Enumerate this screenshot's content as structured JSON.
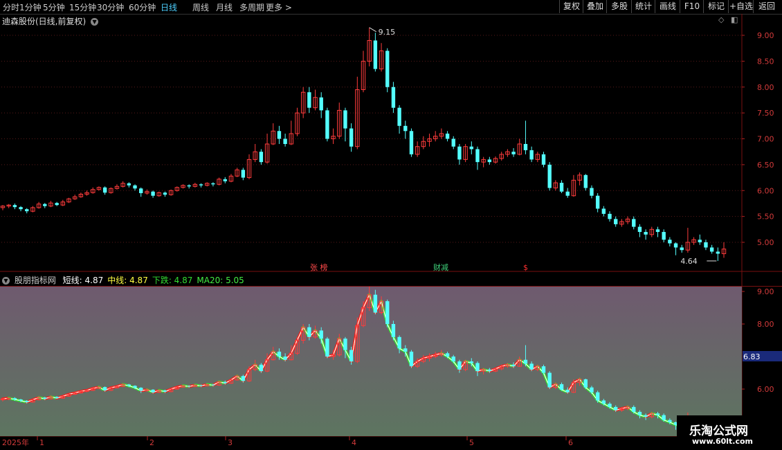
{
  "toolbar": {
    "periods": [
      "分时",
      "1分钟",
      "5分钟",
      "15分钟",
      "30分钟",
      "60分钟",
      "日线",
      "周线",
      "月线",
      "多周期",
      "更多"
    ],
    "active_period": "日线",
    "right_buttons": [
      "复权",
      "叠加",
      "多股",
      "统计",
      "画线",
      "F10",
      "标记",
      "+自选",
      "返回"
    ]
  },
  "main_panel": {
    "title": "迪森股份(日线,前复权)",
    "high_label": "9.15",
    "low_label": "4.64",
    "events": [
      {
        "text": "张 榜",
        "color": "#ff4a4a"
      },
      {
        "text": "财减",
        "color": "#3fd17a"
      },
      {
        "text": "$",
        "color": "#ff3030"
      }
    ],
    "y_ticks": [
      "9.00",
      "8.50",
      "8.00",
      "7.50",
      "7.00",
      "6.50",
      "6.00",
      "5.50",
      "5.00"
    ]
  },
  "indicator_panel": {
    "name": "股朋指标网",
    "legend": [
      {
        "label": "短线:",
        "value": "4.87",
        "color": "#ffffff"
      },
      {
        "label": "中线:",
        "value": "4.87",
        "color": "#ffff44"
      },
      {
        "label": "下跌:",
        "value": "4.87",
        "color": "#33dd33"
      },
      {
        "label": "MA20:",
        "value": "5.05",
        "color": "#44ee44"
      }
    ],
    "y_ticks": [
      "9.00",
      "8.00",
      "6.00"
    ],
    "current_value": "6.83"
  },
  "x_axis": {
    "year": "2025年",
    "months": [
      "1",
      "2",
      "3",
      "4",
      "5",
      "6"
    ]
  },
  "watermark": {
    "line1": "乐淘公式网",
    "line2": "www.60lt.com"
  },
  "chart_data": {
    "type": "candlestick",
    "title": "迪森股份(日线,前复权)",
    "y_range": [
      4.6,
      9.3
    ],
    "candles": [
      [
        5.67,
        5.7,
        5.62,
        5.72
      ],
      [
        5.7,
        5.72,
        5.66,
        5.74
      ],
      [
        5.72,
        5.68,
        5.64,
        5.75
      ],
      [
        5.68,
        5.64,
        5.6,
        5.7
      ],
      [
        5.64,
        5.6,
        5.56,
        5.66
      ],
      [
        5.6,
        5.67,
        5.58,
        5.7
      ],
      [
        5.67,
        5.74,
        5.65,
        5.78
      ],
      [
        5.74,
        5.7,
        5.66,
        5.76
      ],
      [
        5.7,
        5.76,
        5.68,
        5.8
      ],
      [
        5.76,
        5.72,
        5.7,
        5.78
      ],
      [
        5.72,
        5.78,
        5.7,
        5.82
      ],
      [
        5.78,
        5.84,
        5.76,
        5.86
      ],
      [
        5.84,
        5.88,
        5.82,
        5.92
      ],
      [
        5.88,
        5.93,
        5.86,
        5.96
      ],
      [
        5.93,
        5.96,
        5.9,
        6.0
      ],
      [
        5.96,
        6.02,
        5.94,
        6.06
      ],
      [
        6.02,
        6.06,
        6.0,
        6.08
      ],
      [
        6.06,
        5.96,
        5.92,
        6.08
      ],
      [
        5.96,
        6.04,
        5.94,
        6.06
      ],
      [
        6.04,
        6.08,
        6.02,
        6.12
      ],
      [
        6.08,
        6.14,
        6.06,
        6.18
      ],
      [
        6.14,
        6.1,
        6.06,
        6.16
      ],
      [
        6.1,
        6.04,
        6.0,
        6.12
      ],
      [
        6.04,
        5.95,
        5.88,
        6.06
      ],
      [
        5.95,
        5.98,
        5.92,
        6.02
      ],
      [
        5.98,
        5.9,
        5.86,
        6.0
      ],
      [
        5.9,
        5.96,
        5.88,
        5.98
      ],
      [
        5.96,
        5.92,
        5.88,
        5.98
      ],
      [
        5.92,
        6.0,
        5.9,
        6.02
      ],
      [
        6.0,
        6.06,
        5.98,
        6.08
      ],
      [
        6.06,
        6.1,
        6.04,
        6.12
      ],
      [
        6.1,
        6.08,
        6.04,
        6.12
      ],
      [
        6.08,
        6.12,
        6.06,
        6.15
      ],
      [
        6.12,
        6.1,
        6.06,
        6.14
      ],
      [
        6.1,
        6.14,
        6.08,
        6.16
      ],
      [
        6.14,
        6.12,
        6.08,
        6.16
      ],
      [
        6.12,
        6.22,
        6.1,
        6.25
      ],
      [
        6.22,
        6.18,
        6.14,
        6.26
      ],
      [
        6.18,
        6.28,
        6.16,
        6.32
      ],
      [
        6.28,
        6.4,
        6.26,
        6.44
      ],
      [
        6.4,
        6.25,
        6.2,
        6.44
      ],
      [
        6.25,
        6.6,
        6.22,
        6.7
      ],
      [
        6.6,
        6.75,
        6.55,
        6.9
      ],
      [
        6.75,
        6.55,
        6.5,
        6.8
      ],
      [
        6.55,
        6.9,
        6.52,
        7.1
      ],
      [
        6.9,
        7.15,
        6.88,
        7.3
      ],
      [
        7.15,
        7.0,
        6.9,
        7.25
      ],
      [
        7.0,
        6.9,
        6.85,
        7.1
      ],
      [
        6.9,
        7.1,
        6.88,
        7.35
      ],
      [
        7.1,
        7.5,
        7.05,
        7.6
      ],
      [
        7.5,
        7.9,
        7.4,
        8.0
      ],
      [
        7.9,
        7.6,
        7.5,
        8.0
      ],
      [
        7.6,
        7.8,
        7.55,
        7.95
      ],
      [
        7.8,
        7.55,
        7.4,
        7.9
      ],
      [
        7.55,
        7.0,
        6.95,
        7.6
      ],
      [
        7.0,
        7.05,
        6.9,
        7.2
      ],
      [
        7.05,
        7.55,
        7.0,
        7.7
      ],
      [
        7.55,
        7.2,
        6.95,
        7.6
      ],
      [
        7.2,
        6.85,
        6.75,
        7.3
      ],
      [
        6.85,
        7.95,
        6.8,
        8.2
      ],
      [
        7.95,
        8.5,
        7.9,
        8.7
      ],
      [
        8.5,
        8.9,
        8.4,
        9.15
      ],
      [
        8.9,
        8.35,
        8.3,
        9.05
      ],
      [
        8.35,
        8.7,
        8.3,
        8.85
      ],
      [
        8.7,
        8.0,
        7.9,
        8.75
      ],
      [
        8.0,
        7.6,
        7.5,
        8.1
      ],
      [
        7.6,
        7.25,
        7.1,
        7.65
      ],
      [
        7.25,
        7.15,
        7.0,
        7.35
      ],
      [
        7.15,
        6.7,
        6.65,
        7.2
      ],
      [
        6.7,
        6.85,
        6.65,
        6.95
      ],
      [
        6.85,
        6.95,
        6.8,
        7.05
      ],
      [
        6.95,
        7.0,
        6.85,
        7.1
      ],
      [
        7.0,
        7.05,
        6.95,
        7.15
      ],
      [
        7.05,
        7.1,
        7.0,
        7.2
      ],
      [
        7.1,
        7.0,
        6.95,
        7.15
      ],
      [
        7.0,
        6.85,
        6.8,
        7.05
      ],
      [
        6.85,
        6.6,
        6.5,
        6.9
      ],
      [
        6.6,
        6.85,
        6.55,
        6.9
      ],
      [
        6.85,
        6.8,
        6.7,
        6.95
      ],
      [
        6.8,
        6.55,
        6.4,
        6.85
      ],
      [
        6.55,
        6.6,
        6.45,
        6.65
      ],
      [
        6.6,
        6.55,
        6.5,
        6.65
      ],
      [
        6.55,
        6.62,
        6.52,
        6.66
      ],
      [
        6.62,
        6.7,
        6.58,
        6.75
      ],
      [
        6.7,
        6.75,
        6.65,
        6.8
      ],
      [
        6.75,
        6.7,
        6.65,
        6.82
      ],
      [
        6.7,
        6.9,
        6.68,
        7.0
      ],
      [
        6.9,
        6.78,
        6.7,
        7.35
      ],
      [
        6.78,
        6.6,
        6.55,
        6.85
      ],
      [
        6.6,
        6.7,
        6.55,
        6.75
      ],
      [
        6.7,
        6.5,
        6.45,
        6.75
      ],
      [
        6.5,
        6.05,
        6.0,
        6.55
      ],
      [
        6.05,
        6.15,
        6.0,
        6.2
      ],
      [
        6.15,
        5.98,
        5.95,
        6.2
      ],
      [
        5.98,
        5.9,
        5.86,
        6.05
      ],
      [
        5.9,
        6.2,
        5.88,
        6.3
      ],
      [
        6.2,
        6.3,
        6.1,
        6.35
      ],
      [
        6.3,
        6.05,
        6.0,
        6.32
      ],
      [
        6.05,
        5.9,
        5.85,
        6.1
      ],
      [
        5.9,
        5.65,
        5.58,
        5.95
      ],
      [
        5.65,
        5.55,
        5.5,
        5.7
      ],
      [
        5.55,
        5.45,
        5.4,
        5.6
      ],
      [
        5.45,
        5.35,
        5.3,
        5.5
      ],
      [
        5.35,
        5.4,
        5.3,
        5.45
      ],
      [
        5.4,
        5.45,
        5.35,
        5.5
      ],
      [
        5.45,
        5.3,
        5.25,
        5.5
      ],
      [
        5.3,
        5.2,
        5.1,
        5.35
      ],
      [
        5.2,
        5.15,
        5.05,
        5.25
      ],
      [
        5.15,
        5.25,
        5.1,
        5.3
      ],
      [
        5.25,
        5.2,
        5.1,
        5.3
      ],
      [
        5.2,
        5.05,
        5.0,
        5.25
      ],
      [
        5.05,
        4.98,
        4.92,
        5.1
      ],
      [
        4.98,
        4.9,
        4.75,
        5.0
      ],
      [
        4.9,
        4.85,
        4.8,
        4.95
      ],
      [
        4.85,
        5.0,
        4.8,
        5.28
      ],
      [
        5.0,
        5.05,
        4.95,
        5.1
      ],
      [
        5.05,
        5.0,
        4.95,
        5.15
      ],
      [
        5.0,
        4.9,
        4.85,
        5.05
      ],
      [
        4.9,
        4.82,
        4.78,
        4.95
      ],
      [
        4.82,
        4.78,
        4.64,
        4.9
      ],
      [
        4.78,
        4.87,
        4.7,
        5.0
      ]
    ]
  }
}
